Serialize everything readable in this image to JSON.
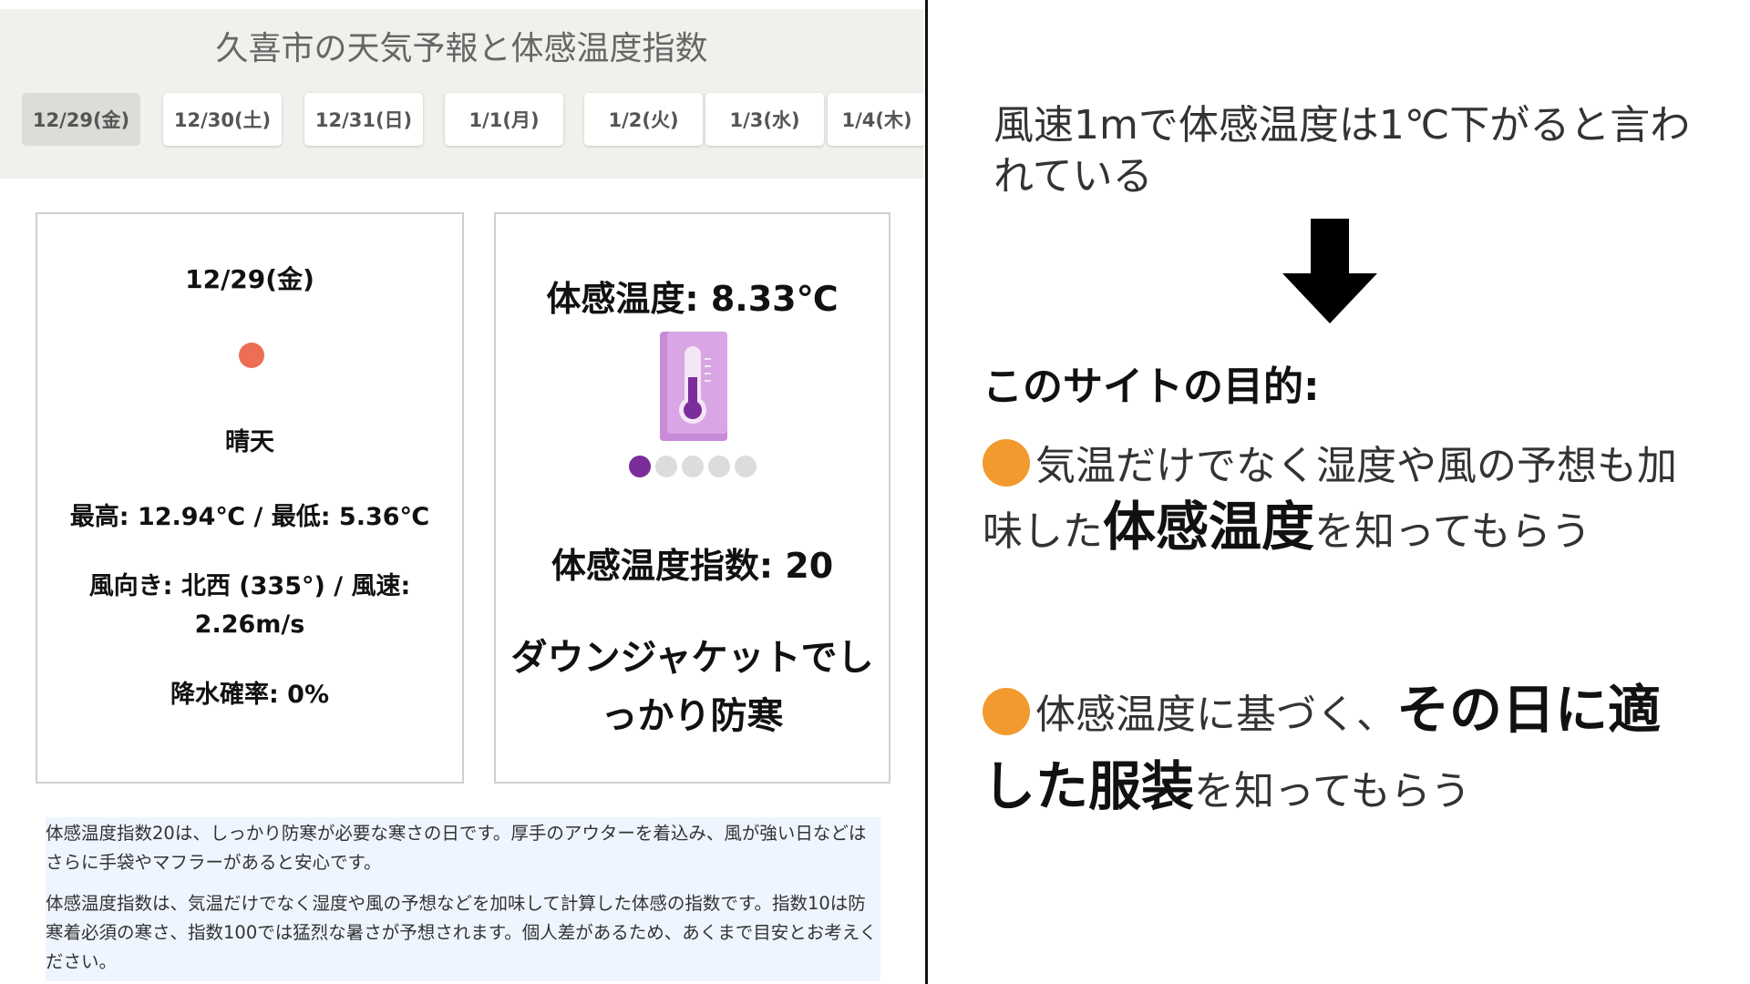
{
  "site": {
    "title": "久喜市の天気予報と体感温度指数",
    "tabs": [
      "12/29(金)",
      "12/30(土)",
      "12/31(日)",
      "1/1(月)",
      "1/2(火)",
      "1/3(水)",
      "1/4(木)"
    ],
    "active_tab": "12/29(金)"
  },
  "weather_card": {
    "date": "12/29(金)",
    "icon": "sun-icon",
    "description": "晴天",
    "temp_range": "最高: 12.94℃ / 最低: 5.36℃",
    "wind": "風向き: 北西 (335°) / 風速: 2.26m/s",
    "precipitation": "降水確率: 0%"
  },
  "feel_card": {
    "feel_temp": "体感温度: 8.33℃",
    "icon": "thermometer-icon",
    "level": 1,
    "level_max": 5,
    "feel_index": "体感温度指数: 20",
    "advice": "ダウンジャケットでしっかり防寒"
  },
  "info": {
    "paragraph_1": "体感温度指数20は、しっかり防寒が必要な寒さの日です。厚手のアウターを着込み、風が強い日などはさらに手袋やマフラーがあると安心です。",
    "paragraph_2": "体感温度指数は、気温だけでなく湿度や風の予想などを加味して計算した体感の指数です。指数10は防寒着必須の寒さ、指数100では猛烈な暑さが予想されます。個人差があるため、あくまで目安とお考えください。"
  },
  "explanation": {
    "premise": "風速1mで体感温度は1℃下がると言われている",
    "heading": "このサイトの目的:",
    "point1_pre": "気温だけでなく湿度や風の予想も加味した",
    "point1_em": "体感温度",
    "point1_post": "を知ってもらう",
    "point2_pre": "体感温度に基づく、",
    "point2_em": "その日に適した服装",
    "point2_post": "を知ってもらう"
  },
  "colors": {
    "header_bg": "#f0f0ec",
    "sun": "#ec6e55",
    "index_active": "#7b2d9a",
    "bullet": "#f39a2f",
    "info_bg": "#eef5ff"
  }
}
